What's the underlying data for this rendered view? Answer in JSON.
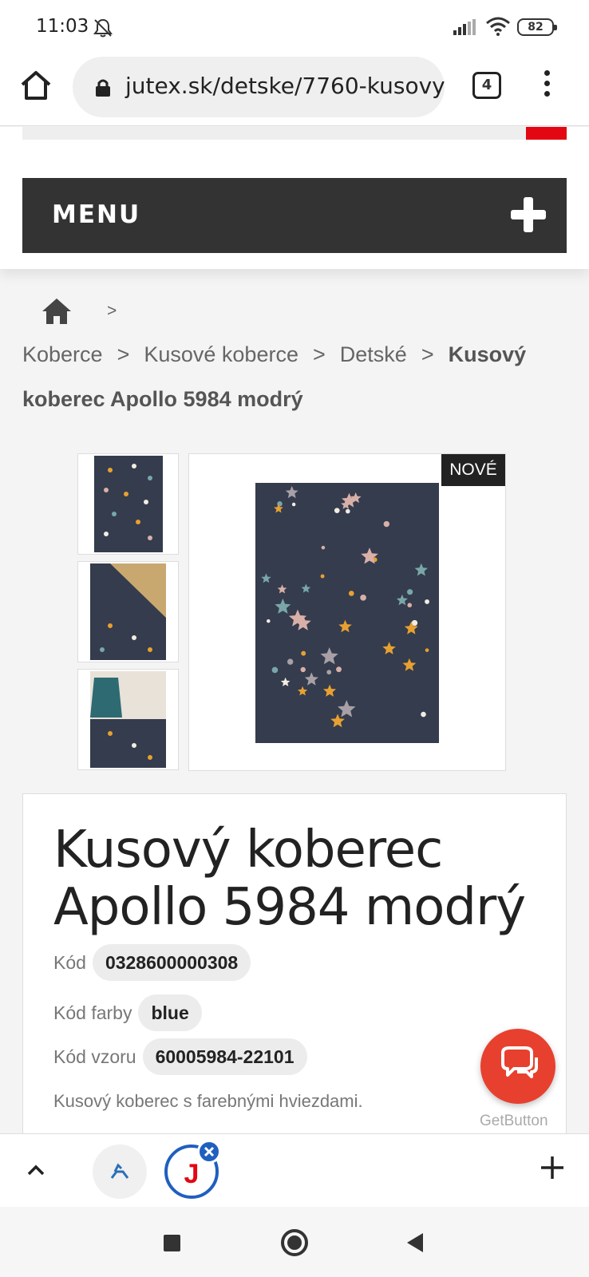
{
  "status_bar": {
    "time": "11:03",
    "battery": "82",
    "icons": [
      "bell-off-icon",
      "signal-icon",
      "wifi-icon",
      "battery-icon"
    ]
  },
  "browser": {
    "url": "jutex.sk/detske/7760-kusovy",
    "tab_count": "4"
  },
  "header": {
    "menu_label": "MENU"
  },
  "breadcrumb": {
    "sep": ">",
    "items": [
      "Koberce",
      "Kusové koberce",
      "Detské"
    ],
    "current": "Kusový koberec Apollo 5984 modrý"
  },
  "gallery": {
    "badge": "NOVÉ",
    "thumbnail_count": 3,
    "colors": {
      "rug": "#343c4d",
      "star_orange": "#e8a030",
      "star_pink": "#d8b0a8",
      "star_teal": "#7aa6a8",
      "star_grey": "#a8a0a6",
      "star_white": "#f2ece4"
    }
  },
  "product": {
    "title": "Kusový koberec Apollo 5984 modrý",
    "code_label": "Kód",
    "code_value": "0328600000308",
    "color_label": "Kód farby",
    "color_value": "blue",
    "pattern_label": "Kód vzoru",
    "pattern_value": "60005984-22101",
    "description": "Kusový koberec s farebnými hviezdami."
  },
  "getbutton": {
    "label": "GetButton",
    "color": "#e8402f"
  },
  "toolbar": {
    "active_tab_letter": "J",
    "accent": "#1f5fbf"
  }
}
